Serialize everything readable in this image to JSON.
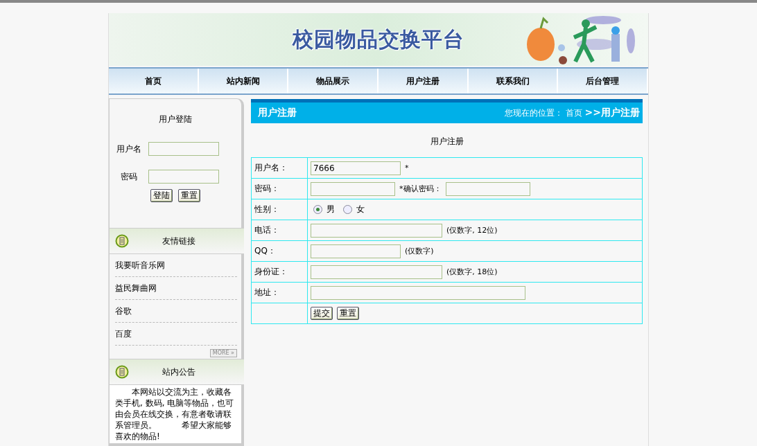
{
  "banner": {
    "title": "校园物品交换平台"
  },
  "nav": [
    {
      "label": "首页"
    },
    {
      "label": "站内新闻"
    },
    {
      "label": "物品展示"
    },
    {
      "label": "用户注册"
    },
    {
      "label": "联系我们"
    },
    {
      "label": "后台管理"
    }
  ],
  "login": {
    "title": "用户登陆",
    "fields": [
      {
        "label": "用户名"
      },
      {
        "label": "密码"
      }
    ],
    "buttons": [
      "登陆",
      "重置"
    ]
  },
  "links": {
    "title": "友情链接",
    "items": [
      "我要听音乐网",
      "益民舞曲网",
      "谷歌",
      "百度"
    ],
    "more": "MORE »"
  },
  "notice": {
    "title": "站内公告",
    "text": "本网站以交流为主，收藏各类手机, 数码, 电脑等物品，也可由会员在线交换，有意者敬请联系管理员。　　　希望大家能够喜欢的物品!"
  },
  "main": {
    "title": "用户注册",
    "breadcrumb_prefix": "您现在的位置：",
    "breadcrumb_home": "首页",
    "breadcrumb_current": ">>用户注册",
    "form_title": "用户注册",
    "rows": [
      {
        "kind": "text",
        "label": "用户名：",
        "value": "7666",
        "note": "*"
      },
      {
        "kind": "password",
        "label": "密码：",
        "note": "*确认密码："
      },
      {
        "kind": "radio",
        "label": "性别：",
        "options": [
          {
            "label": "男",
            "selected": true
          },
          {
            "label": "女",
            "selected": false
          }
        ]
      },
      {
        "kind": "text",
        "label": "电话：",
        "note": "(仅数字, 12位)"
      },
      {
        "kind": "text",
        "label": "QQ：",
        "note": "(仅数字)"
      },
      {
        "kind": "text",
        "label": "身份证：",
        "note": "(仅数字, 18位)"
      },
      {
        "kind": "text",
        "label": "地址："
      },
      {
        "kind": "buttons",
        "buttons": [
          "提交",
          "重置"
        ]
      }
    ]
  }
}
